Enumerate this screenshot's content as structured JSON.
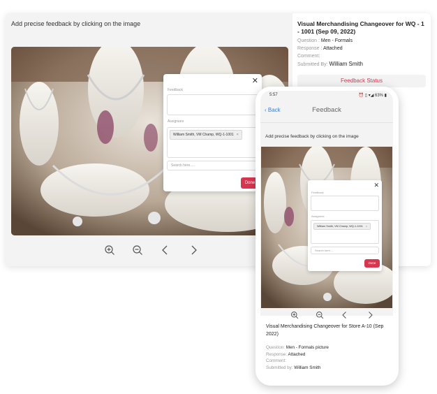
{
  "desktop": {
    "title": "Add precise feedback by clicking on the image",
    "side": {
      "title": "Visual Merchandising Changeover for WQ - 1 - 1001 (Sep 09, 2022)",
      "question_label": "Question : ",
      "question_value": "Men - Formals",
      "response_label": "Response : ",
      "response_value": "Attached",
      "comment_label": "Comment:",
      "submitted_label": "Submitted By: ",
      "submitted_value": "William Smith",
      "feedback_status": "Feedback Status"
    },
    "popup": {
      "feedback_label": "Feedback",
      "assignees_label": "Assignees",
      "chip": "William Smith, VM Champ, WQ-1-1001",
      "chip_remove": "×",
      "search_placeholder": "Search here.....",
      "done": "Done",
      "close": "✕"
    }
  },
  "phone": {
    "time": "5:57",
    "status_right": "⏰ ▯ ▾◢ 63% ▮",
    "back": "Back",
    "nav_title": "Feedback",
    "title": "Add precise feedback by clicking on the image",
    "popup": {
      "feedback_label": "Feedback",
      "assignees_label": "Assignees",
      "chip": "William Smith, VM Champ, WQ-1-1001",
      "chip_remove": "×",
      "search_placeholder": "Search here.....",
      "done": "Done",
      "close": "✕"
    },
    "info": {
      "title": "Visual Merchandising Changeover for Store A-10 (Sep 2022)",
      "question_label": "Question: ",
      "question_value": "Men -  Formals picture",
      "response_label": "Response: ",
      "response_value": "Attached",
      "comment_label": "Comment:",
      "submitted_label": "Submitted by: ",
      "submitted_value": "William Smith"
    }
  },
  "icons": [
    "zoom-in-icon",
    "zoom-out-icon",
    "chevron-left-icon",
    "chevron-right-icon",
    "close-icon",
    "back-chevron-icon"
  ],
  "colors": {
    "accent": "#d8364f",
    "link": "#3b7fd4",
    "panel": "#f3f3f3"
  }
}
